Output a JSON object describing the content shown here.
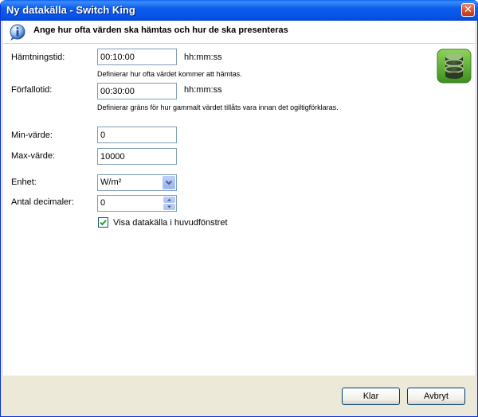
{
  "window": {
    "title": "Ny datakälla - Switch King",
    "close_glyph": "✕"
  },
  "header": {
    "text": "Ange hur ofta värden ska hämtas och hur de ska presenteras"
  },
  "form": {
    "fetch_time": {
      "label": "Hämtningstid:",
      "value": "00:10:00",
      "unit": "hh:mm:ss",
      "hint": "Definierar hur ofta värdet kommer att hämtas."
    },
    "expire_time": {
      "label": "Förfallotid:",
      "value": "00:30:00",
      "unit": "hh:mm:ss",
      "hint": "Definierar gräns för hur gammalt värdet tillåts vara innan det ogiltigförklaras."
    },
    "min_value": {
      "label": "Min-värde:",
      "value": "0"
    },
    "max_value": {
      "label": "Max-värde:",
      "value": "10000"
    },
    "unit": {
      "label": "Enhet:",
      "selected": "W/m²"
    },
    "decimals": {
      "label": "Antal decimaler:",
      "value": "0"
    },
    "show_in_main": {
      "label": "Visa datakälla i huvudfönstret",
      "checked": true
    }
  },
  "buttons": {
    "ok": "Klar",
    "cancel": "Avbryt"
  },
  "colors": {
    "titlebar": "#0553e6",
    "dialog_bg": "#ece9d8",
    "input_border": "#7f9db9",
    "db_icon_green": "#4aa628"
  },
  "icons": {
    "info": "info-icon",
    "database": "database-icon",
    "close": "close-icon",
    "dropdown": "chevron-down-icon",
    "spinner": "spin-arrows-icon",
    "check": "checkmark-icon"
  }
}
